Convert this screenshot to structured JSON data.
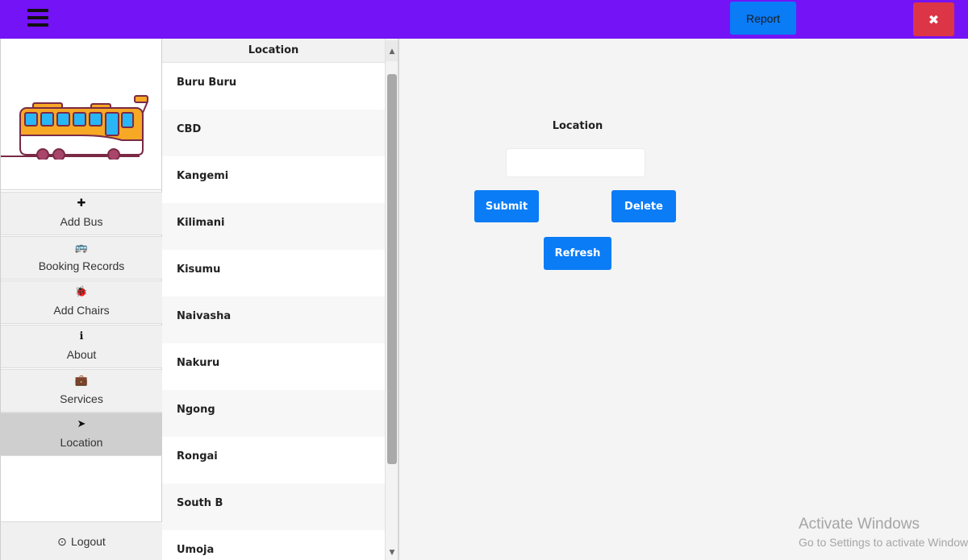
{
  "topbar": {
    "report_label": "Report",
    "close_label": "✖",
    "colors": {
      "bar": "#7413f6",
      "report": "#0a7cf6",
      "close": "#dc3545"
    }
  },
  "sidebar": {
    "items": [
      {
        "label": "Add Bus",
        "icon": "plus-icon",
        "glyph": "✚"
      },
      {
        "label": "Booking Records",
        "icon": "bus-icon",
        "glyph": "🚌"
      },
      {
        "label": "Add Chairs",
        "icon": "bug-icon",
        "glyph": "🐞"
      },
      {
        "label": "About",
        "icon": "info-circle-icon",
        "glyph": "ℹ"
      },
      {
        "label": "Services",
        "icon": "briefcase-icon",
        "glyph": "💼"
      },
      {
        "label": "Location",
        "icon": "location-arrow-icon",
        "glyph": "➤"
      }
    ],
    "active": "Location",
    "logout_label": "Logout",
    "logout_glyph": "⊙"
  },
  "location_list": {
    "header": "Location",
    "rows": [
      "Buru Buru",
      "CBD",
      "Kangemi",
      "Kilimani",
      "Kisumu",
      "Naivasha",
      "Nakuru",
      "Ngong",
      "Rongai",
      "South B",
      "Umoja"
    ]
  },
  "form": {
    "label": "Location",
    "input_value": "",
    "submit_label": "Submit",
    "delete_label": "Delete",
    "refresh_label": "Refresh"
  },
  "watermark": {
    "line1": "Activate Windows",
    "line2": "Go to Settings to activate Windows."
  }
}
